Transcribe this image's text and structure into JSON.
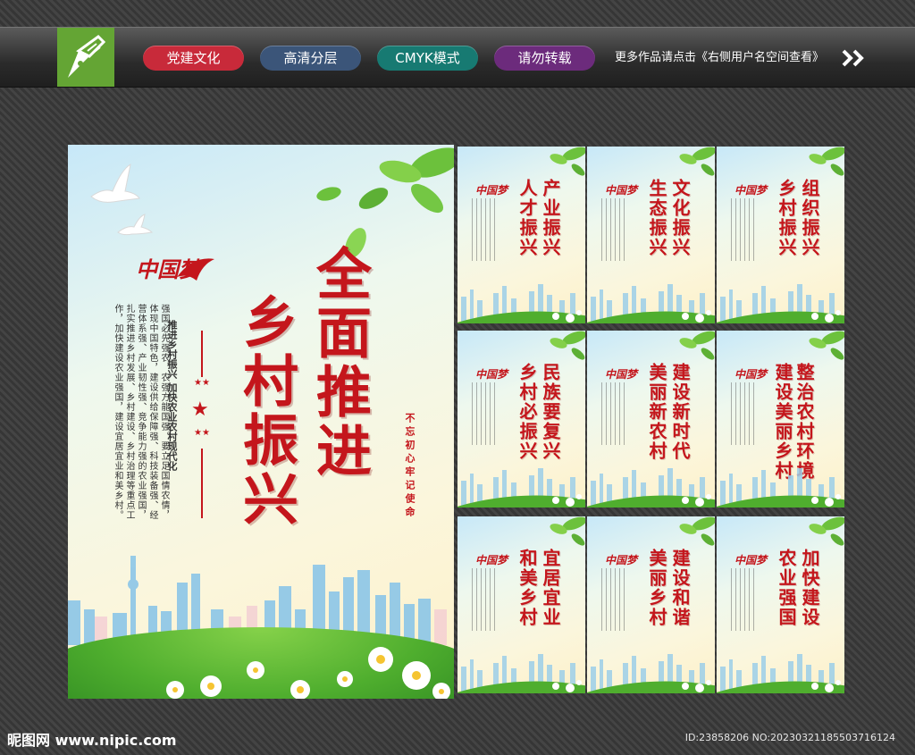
{
  "header": {
    "tags": [
      "党建文化",
      "高清分层",
      "CMYK模式",
      "请勿转载"
    ],
    "more_text": "更多作品请点击《右侧用户名空间查看》",
    "tag_colors": [
      "#c82a3a",
      "#3b5579",
      "#177a72",
      "#6c2b7c"
    ]
  },
  "main_poster": {
    "brand": "中国梦",
    "title_col_1": "全面推进",
    "title_col_2": "乡村振兴",
    "subtitle": "推进乡村振兴 加快农业农村现代化",
    "body": "强国必先强农，农强方能国强。要立足国情农情，体现中国特色，建设供给保障强、科技装备强、经营体系强、产业韧性强、竞争能力强的农业强国，扎实推进乡村发展、乡村建设、乡村治理等重点工作，加快建设农业强国，建设宜居宜业和美乡村。",
    "slogan_1": "不忘初心",
    "slogan_2": "牢记使命",
    "accent_color": "#c4161c"
  },
  "small_posters": [
    {
      "col_1": "产业振兴",
      "col_2": "人才振兴"
    },
    {
      "col_1": "文化振兴",
      "col_2": "生态振兴"
    },
    {
      "col_1": "组织振兴",
      "col_2": "乡村振兴"
    },
    {
      "col_1": "民族要复兴",
      "col_2": "乡村必振兴"
    },
    {
      "col_1": "建设新时代",
      "col_2": "美丽新农村"
    },
    {
      "col_1": "整治农村环境",
      "col_2": "建设美丽乡村"
    },
    {
      "col_1": "宜居宜业",
      "col_2": "和美乡村"
    },
    {
      "col_1": "建设和谐",
      "col_2": "美丽乡村"
    },
    {
      "col_1": "加快建设",
      "col_2": "农业强国"
    }
  ],
  "small_brand": "中国梦",
  "footer": {
    "site": "昵图网 www.nipic.com",
    "id": "ID:23858206 NO:20230321185503716124"
  }
}
